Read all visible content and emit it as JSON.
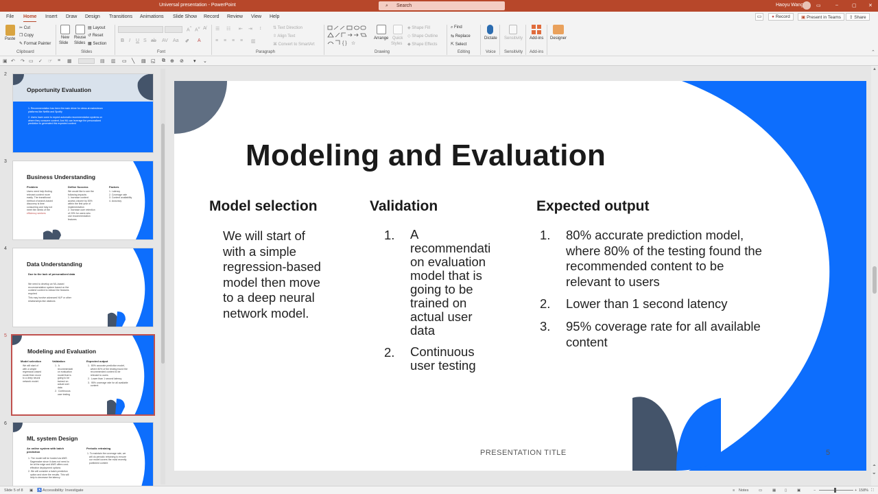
{
  "window": {
    "doc_title": "Universal presentation  -  PowerPoint",
    "search_placeholder": "Search",
    "user_name": "Haoyu Wang",
    "min": "–",
    "max": "▢",
    "close": "✕"
  },
  "menu": {
    "tabs": [
      "File",
      "Home",
      "Insert",
      "Draw",
      "Design",
      "Transitions",
      "Animations",
      "Slide Show",
      "Record",
      "Review",
      "View",
      "Help"
    ],
    "record_btn": "Record",
    "present_btn": "Present in Teams",
    "share_btn": "Share"
  },
  "ribbon": {
    "paste": "Paste",
    "cut": "Cut",
    "copy": "Copy",
    "format_painter": "Format Painter",
    "clipboard": "Clipboard",
    "new_slide_1": "New",
    "new_slide_2": "Slide",
    "reuse_1": "Reuse",
    "reuse_2": "Slides",
    "layout": "Layout",
    "reset": "Reset",
    "section": "Section",
    "slides": "Slides",
    "font": "Font",
    "paragraph": "Paragraph",
    "text_direction": "Text Direction",
    "align_text": "Align Text",
    "convert_smartart": "Convert to SmartArt",
    "arrange": "Arrange",
    "quick_1": "Quick",
    "quick_2": "Styles",
    "shape_fill": "Shape Fill",
    "shape_outline": "Shape Outline",
    "shape_effects": "Shape Effects",
    "drawing": "Drawing",
    "find": "Find",
    "replace": "Replace",
    "select": "Select",
    "editing": "Editing",
    "dictate": "Dictate",
    "voice": "Voice",
    "sensitivity": "Sensitivity",
    "addins": "Add-ins",
    "designer": "Designer"
  },
  "thumbs": [
    {
      "num": "2",
      "title": "Opportunity Evaluation",
      "lines": [
        "1.  Recommendation has been the main driver for views at mainstream",
        "     platforms like Netflix and Spotify",
        "2.  Users have come to expect automatic recommendation systems on",
        "     where they consume content. And ML can leverage the personalized",
        "     prediction to generated this expected content"
      ]
    },
    {
      "num": "3",
      "title": "Business Understanding",
      "heads": [
        "Problem",
        "Define Success",
        "Factors"
      ],
      "col1": [
        "Users need help finding",
        "relevant content more",
        "easily. The transitional",
        "method of search-based",
        "discovery is time",
        "consuming and may not",
        "meet the needs of the",
        "efficiency seekers"
      ],
      "col2": [
        "We would like to see the",
        "following impacts:",
        "1. Increase content",
        "   access volume by 50%",
        "   within the first year of",
        "   implementation",
        "2. Increase user retention",
        "   of 20% for users who",
        "   use recommendation",
        "   features"
      ],
      "col3": [
        "1. Latency",
        "2. Coverage rate",
        "3. Content availability",
        "4. Accuracy"
      ]
    },
    {
      "num": "4",
      "title": "Data Understanding",
      "sub": "Due to the lack of personalized data",
      "lines": [
        "We need to develop an ML-based",
        "recommendation system based on the",
        "content/ context to extract the features",
        "required",
        "This may involve advanced NLP or other",
        "relationships like citations"
      ]
    },
    {
      "num": "5",
      "title": "Modeling and Evaluation",
      "heads": [
        "Model selection",
        "Validation",
        "Expected output"
      ],
      "col1": [
        "We will start of",
        "with a simple",
        "regression-based",
        "model then move",
        "to a deep neural",
        "network model."
      ],
      "col2": [
        "1.  A",
        "    recommendati",
        "    on evaluation",
        "    model that is",
        "    going to be",
        "    trained on",
        "    actual user",
        "    data",
        "2.  Continuous",
        "    user testing"
      ],
      "col3": [
        "1.  80% accurate prediction model,",
        "    where 80% of the testing found the",
        "    recommended content to be",
        "    relevant to users",
        "2.  Lower than 1 second latency",
        "3.  95% coverage rate for all available",
        "    content"
      ]
    },
    {
      "num": "6",
      "title": "ML system Design",
      "heads": [
        "An online system with batch",
        "prediction",
        "Periodic retraining"
      ],
      "col1": [
        "1. The model will be hosted via AWS",
        "   Sagemaker since it does not need to",
        "   be at the edge and AWS offers cost-",
        "   effective deployment options",
        "2. We will consider a batch prediction",
        "   option and store the results. This will",
        "   help to decrease the latency"
      ],
      "col2": [
        "1. To maintain the coverage rate, we",
        "   will do periodic retraining to ensure",
        "   our model covers the most recently",
        "   published content"
      ]
    }
  ],
  "slide": {
    "title": "Modeling and Evaluation",
    "model_selection": {
      "heading": "Model selection",
      "lines": [
        "We will start of",
        "with a simple",
        "regression-based",
        "model then move",
        "to a deep neural",
        "network model."
      ]
    },
    "validation": {
      "heading": "Validation",
      "items": [
        {
          "n": "1.",
          "lines": [
            "A",
            "recommendati",
            "on evaluation",
            "model that is",
            "going to be",
            "trained on",
            "actual user",
            "data"
          ]
        },
        {
          "n": "2.",
          "lines": [
            "Continuous",
            "user testing"
          ]
        }
      ]
    },
    "expected": {
      "heading": "Expected output",
      "items": [
        {
          "n": "1.",
          "lines": [
            "80% accurate prediction model,",
            "where 80% of the testing found the",
            "recommended content to be",
            "relevant to users"
          ]
        },
        {
          "n": "2.",
          "lines": [
            "Lower than 1 second latency"
          ]
        },
        {
          "n": "3.",
          "lines": [
            "95% coverage rate for all available",
            "content"
          ]
        }
      ]
    },
    "footer": "PRESENTATION TITLE",
    "number": "5"
  },
  "status": {
    "slide_of": "Slide 5 of 8",
    "accessibility": "Accessibility: Investigate",
    "notes": "Notes",
    "zoom": "158%"
  },
  "colors": {
    "accent": "#b7472a",
    "slide_blue": "#0d6efd",
    "slide_slate": "#44546a"
  }
}
